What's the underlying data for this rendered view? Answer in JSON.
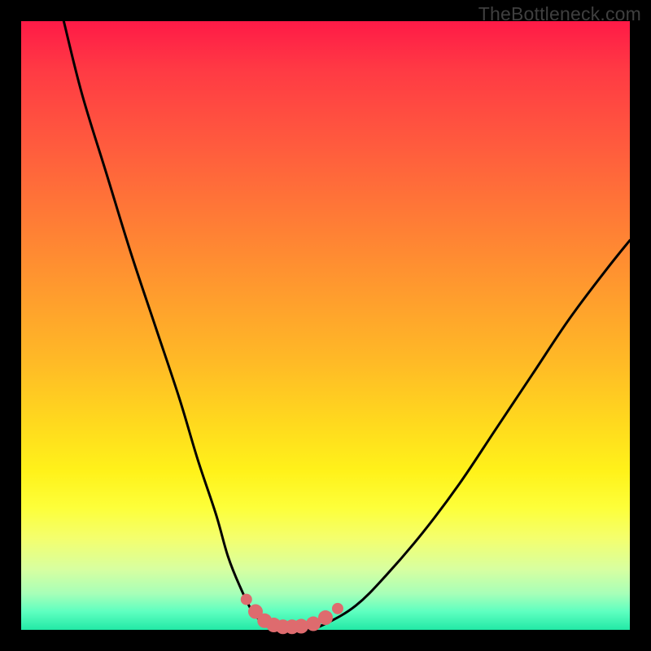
{
  "watermark": "TheBottleneck.com",
  "colors": {
    "frame": "#000000",
    "curve_stroke": "#000000",
    "marker_fill": "#de6b6e",
    "gradient_top": "#ff1a47",
    "gradient_bottom": "#22e9a6"
  },
  "chart_data": {
    "type": "line",
    "title": "",
    "xlabel": "",
    "ylabel": "",
    "xlim": [
      0,
      100
    ],
    "ylim": [
      0,
      100
    ],
    "series": [
      {
        "name": "bottleneck-curve",
        "x": [
          7,
          10,
          14,
          18,
          22,
          26,
          29,
          32,
          34,
          36,
          38,
          40,
          42,
          44,
          47,
          50,
          55,
          60,
          66,
          72,
          78,
          84,
          90,
          96,
          100
        ],
        "y": [
          100,
          88,
          75,
          62,
          50,
          38,
          28,
          19,
          12,
          7,
          3,
          1,
          0,
          0,
          0,
          1,
          4,
          9,
          16,
          24,
          33,
          42,
          51,
          59,
          64
        ]
      }
    ],
    "markers": {
      "name": "trough-dots",
      "x": [
        37,
        38.5,
        40,
        41.5,
        43,
        44.5,
        46,
        48,
        50,
        52
      ],
      "y": [
        5,
        3,
        1.5,
        0.8,
        0.5,
        0.5,
        0.6,
        1,
        2,
        3.5
      ]
    }
  }
}
